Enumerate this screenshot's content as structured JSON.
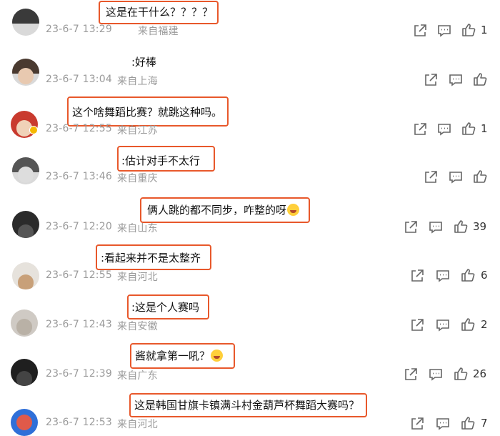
{
  "comments": [
    {
      "text": "这是在干什么？？？？",
      "time": "23-6-7 13:29",
      "loc": "来自福建",
      "likes": "1"
    },
    {
      "text": ":好棒",
      "time": "23-6-7 13:04",
      "loc": "来自上海",
      "likes": ""
    },
    {
      "text": "这个啥舞蹈比赛？就跳这种吗。",
      "time": "23-6-7 12:55",
      "loc": "来自江苏",
      "likes": "1"
    },
    {
      "text": ":估计对手不太行",
      "time": "23-6-7 13:46",
      "loc": "来自重庆",
      "likes": ""
    },
    {
      "text": "俩人跳的都不同步，咋整的呀",
      "time": "23-6-7 12:20",
      "loc": "来自山东",
      "likes": "39"
    },
    {
      "text": ":看起来并不是太整齐",
      "time": "23-6-7 12:55",
      "loc": "来自河北",
      "likes": "6"
    },
    {
      "text": ":这是个人赛吗",
      "time": "23-6-7 12:43",
      "loc": "来自安徽",
      "likes": "2"
    },
    {
      "text": "酱就拿第一吼？",
      "time": "23-6-7 12:39",
      "loc": "来自广东",
      "likes": "26"
    },
    {
      "text": "这是韩国甘旗卡镇满斗村金葫芦杯舞蹈大赛吗？",
      "time": "23-6-7 12:53",
      "loc": "来自河北",
      "likes": "7"
    }
  ],
  "icons": {
    "share": "share-icon",
    "reply": "comment-icon",
    "like": "thumbs-up-icon",
    "emoji": "laughing-emoji-icon",
    "verified": "verified-badge-icon"
  },
  "colors": {
    "highlight": "#e8582b",
    "meta": "#9a9a9a",
    "badge": "#f5b800"
  }
}
